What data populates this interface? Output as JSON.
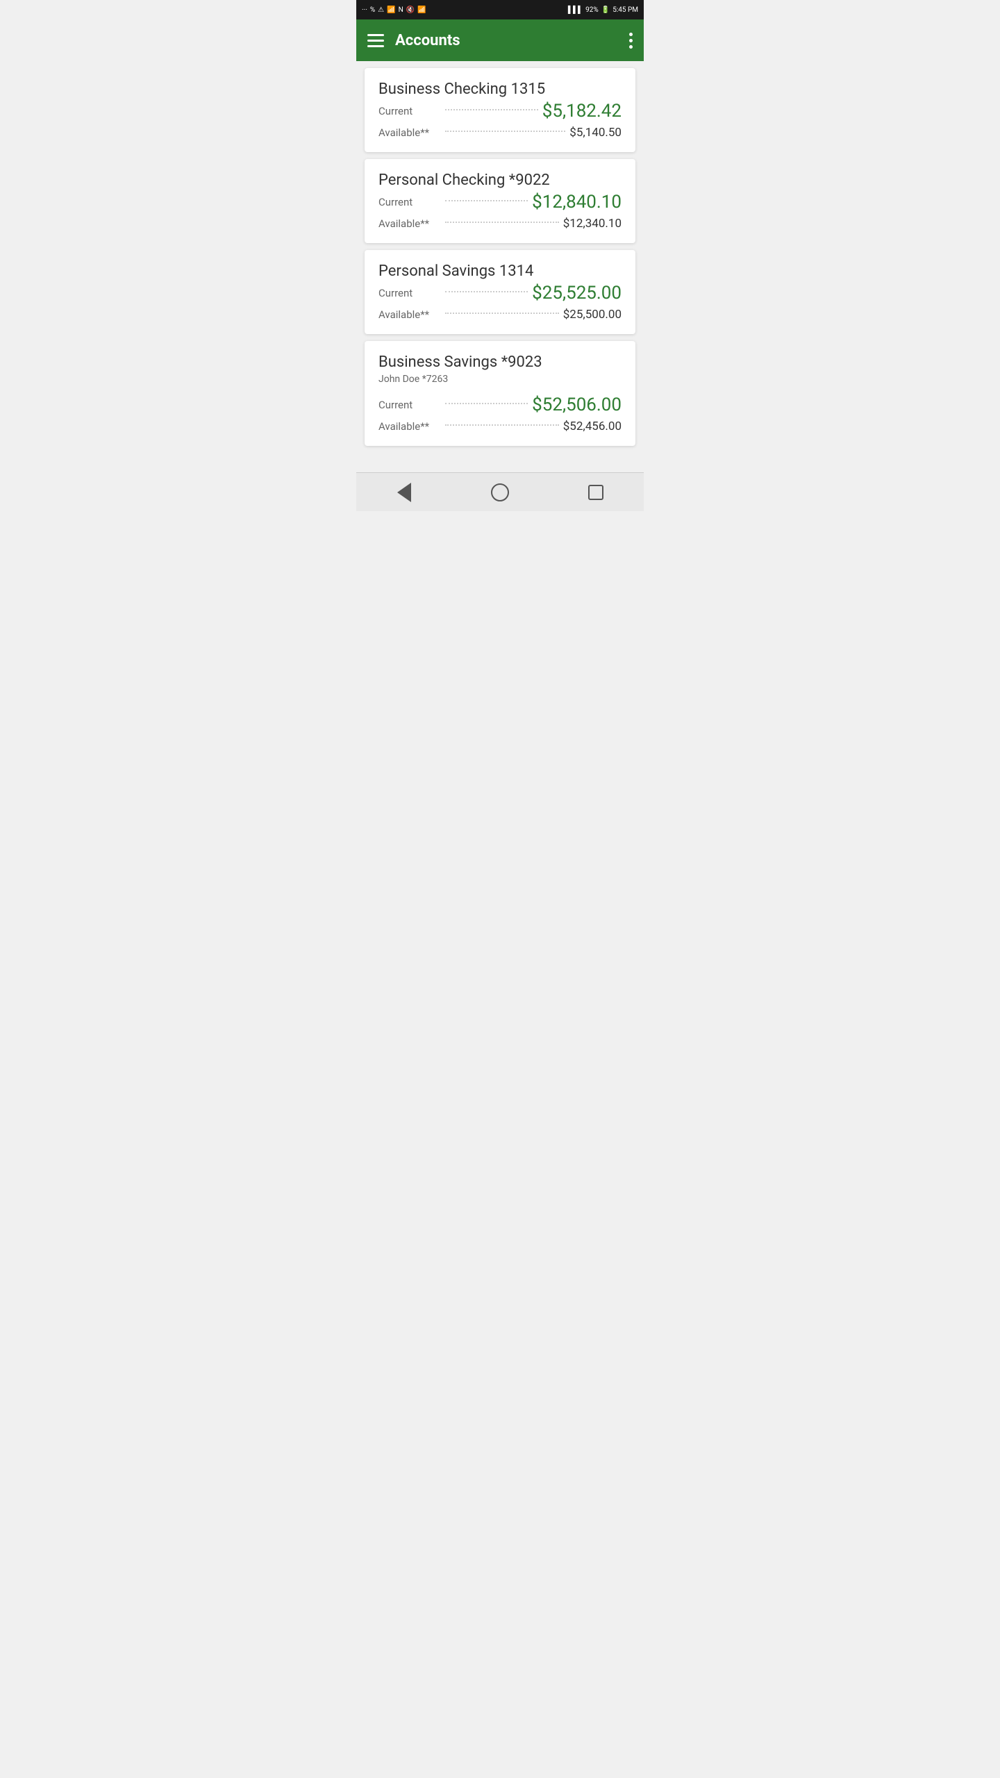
{
  "statusBar": {
    "time": "5:45 PM",
    "battery": "92%",
    "batteryCharging": true
  },
  "header": {
    "title": "Accounts",
    "menuIcon": "menu-icon",
    "moreIcon": "more-icon"
  },
  "accounts": [
    {
      "id": "business-checking",
      "name": "Business Checking 1315",
      "subtitle": "",
      "current": "$5,182.42",
      "available": "$5,140.50",
      "currentLabel": "Current",
      "availableLabel": "Available**"
    },
    {
      "id": "personal-checking",
      "name": "Personal Checking *9022",
      "subtitle": "",
      "current": "$12,840.10",
      "available": "$12,340.10",
      "currentLabel": "Current",
      "availableLabel": "Available**"
    },
    {
      "id": "personal-savings",
      "name": "Personal Savings 1314",
      "subtitle": "",
      "current": "$25,525.00",
      "available": "$25,500.00",
      "currentLabel": "Current",
      "availableLabel": "Available**"
    },
    {
      "id": "business-savings",
      "name": "Business Savings *9023",
      "subtitle": "John Doe *7263",
      "current": "$52,506.00",
      "available": "$52,456.00",
      "currentLabel": "Current",
      "availableLabel": "Available**"
    }
  ],
  "navigation": {
    "back": "Back",
    "home": "Home",
    "recent": "Recent Apps"
  }
}
